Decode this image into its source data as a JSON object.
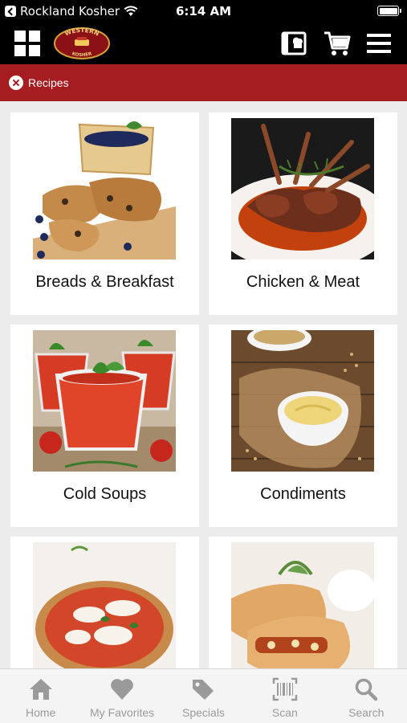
{
  "status_bar": {
    "carrier": "Rockland Kosher",
    "time": "6:14 AM"
  },
  "header": {
    "logo": {
      "top_text": "WESTERN",
      "bottom_text": "KOSHER"
    }
  },
  "breadcrumb": {
    "label": "Recipes"
  },
  "categories": [
    {
      "title": "Breads & Breakfast"
    },
    {
      "title": "Chicken & Meat"
    },
    {
      "title": "Cold Soups"
    },
    {
      "title": "Condiments"
    },
    {
      "title": ""
    },
    {
      "title": ""
    }
  ],
  "tabs": [
    {
      "label": "Home",
      "icon": "home-icon"
    },
    {
      "label": "My Favorites",
      "icon": "heart-icon"
    },
    {
      "label": "Specials",
      "icon": "tag-icon"
    },
    {
      "label": "Scan",
      "icon": "barcode-icon"
    },
    {
      "label": "Search",
      "icon": "search-icon"
    }
  ],
  "colors": {
    "brand_red": "#a51c21",
    "header_bg": "#000000",
    "tab_inactive": "#9a9a9a"
  }
}
